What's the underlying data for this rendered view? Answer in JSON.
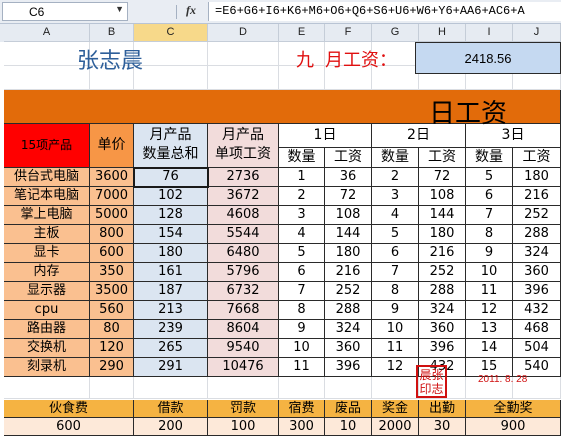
{
  "formula_bar": {
    "cell_ref": "C6",
    "fx": "fx",
    "formula": "=E6+G6+I6+K6+M6+O6+Q6+S6+U6+W6+Y6+AA6+AC6+A"
  },
  "columns": [
    "A",
    "B",
    "C",
    "D",
    "E",
    "F",
    "G",
    "H",
    "I",
    "J"
  ],
  "selected_column": "C",
  "sheet": {
    "employee_name": "张志晨",
    "month": "九",
    "salary_label": "月工资：",
    "salary_value": "2418.56",
    "banner_title": "日工资",
    "headers": {
      "product": "15项产品",
      "price": "单价",
      "monthly_qty": "月产品\n数量总和",
      "monthly_wage": "月产品\n单项工资",
      "days": [
        "1日",
        "2日",
        "3日"
      ],
      "qty": "数量",
      "wage": "工资"
    },
    "rows": [
      {
        "product": "供台式电脑",
        "price": "3600",
        "total_qty": "76",
        "total_wage": "2736",
        "d1q": "1",
        "d1w": "36",
        "d2q": "2",
        "d2w": "72",
        "d3q": "5",
        "d3w": "180"
      },
      {
        "product": "笔记本电脑",
        "price": "7000",
        "total_qty": "102",
        "total_wage": "3672",
        "d1q": "2",
        "d1w": "72",
        "d2q": "3",
        "d2w": "108",
        "d3q": "6",
        "d3w": "216"
      },
      {
        "product": "掌上电脑",
        "price": "5000",
        "total_qty": "128",
        "total_wage": "4608",
        "d1q": "3",
        "d1w": "108",
        "d2q": "4",
        "d2w": "144",
        "d3q": "7",
        "d3w": "252"
      },
      {
        "product": "主板",
        "price": "800",
        "total_qty": "154",
        "total_wage": "5544",
        "d1q": "4",
        "d1w": "144",
        "d2q": "5",
        "d2w": "180",
        "d3q": "8",
        "d3w": "288"
      },
      {
        "product": "显卡",
        "price": "600",
        "total_qty": "180",
        "total_wage": "6480",
        "d1q": "5",
        "d1w": "180",
        "d2q": "6",
        "d2w": "216",
        "d3q": "9",
        "d3w": "324"
      },
      {
        "product": "内存",
        "price": "350",
        "total_qty": "161",
        "total_wage": "5796",
        "d1q": "6",
        "d1w": "216",
        "d2q": "7",
        "d2w": "252",
        "d3q": "10",
        "d3w": "360"
      },
      {
        "product": "显示器",
        "price": "3500",
        "total_qty": "187",
        "total_wage": "6732",
        "d1q": "7",
        "d1w": "252",
        "d2q": "8",
        "d2w": "288",
        "d3q": "11",
        "d3w": "396"
      },
      {
        "product": "cpu",
        "price": "560",
        "total_qty": "213",
        "total_wage": "7668",
        "d1q": "8",
        "d1w": "288",
        "d2q": "9",
        "d2w": "324",
        "d3q": "12",
        "d3w": "432"
      },
      {
        "product": "路由器",
        "price": "80",
        "total_qty": "239",
        "total_wage": "8604",
        "d1q": "9",
        "d1w": "324",
        "d2q": "10",
        "d2w": "360",
        "d3q": "13",
        "d3w": "468"
      },
      {
        "product": "交换机",
        "price": "120",
        "total_qty": "265",
        "total_wage": "9540",
        "d1q": "10",
        "d1w": "360",
        "d2q": "11",
        "d2w": "396",
        "d3q": "14",
        "d3w": "504"
      },
      {
        "product": "刻录机",
        "price": "290",
        "total_qty": "291",
        "total_wage": "10476",
        "d1q": "11",
        "d1w": "396",
        "d2q": "12",
        "d2w": "432",
        "d3q": "15",
        "d3w": "540"
      }
    ],
    "stamp": "晨张\n印志",
    "date": "2011. 8. 28",
    "deductions": {
      "labels": [
        "伙食费",
        "借款",
        "罚款",
        "宿费",
        "废品",
        "奖金",
        "出勤",
        "全勤奖"
      ],
      "values": [
        "600",
        "200",
        "100",
        "300",
        "10",
        "2000",
        "30",
        "900"
      ]
    }
  },
  "colors": {
    "banner": "#e26b0a",
    "header_red": "#ff0000",
    "header_orange": "#f79646",
    "light_blue": "#dbe5f1",
    "light_pink": "#f2dcdb",
    "stamp_red": "#d01010"
  }
}
